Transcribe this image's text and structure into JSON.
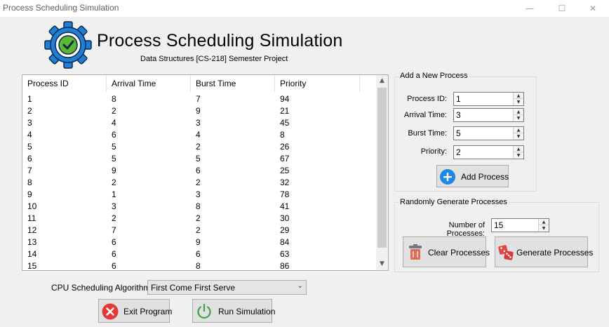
{
  "window": {
    "title": "Process Scheduling Simulation"
  },
  "header": {
    "title": "Process Scheduling Simulation",
    "subtitle": "Data Structures [CS-218] Semester Project"
  },
  "table": {
    "columns": [
      "Process ID",
      "Arrival Time",
      "Burst Time",
      "Priority"
    ],
    "rows": [
      [
        "1",
        "8",
        "7",
        "94"
      ],
      [
        "2",
        "2",
        "9",
        "21"
      ],
      [
        "3",
        "4",
        "3",
        "45"
      ],
      [
        "4",
        "6",
        "4",
        "8"
      ],
      [
        "5",
        "5",
        "2",
        "26"
      ],
      [
        "6",
        "5",
        "5",
        "67"
      ],
      [
        "7",
        "9",
        "6",
        "25"
      ],
      [
        "8",
        "2",
        "2",
        "32"
      ],
      [
        "9",
        "1",
        "3",
        "78"
      ],
      [
        "10",
        "3",
        "8",
        "41"
      ],
      [
        "11",
        "2",
        "2",
        "30"
      ],
      [
        "12",
        "7",
        "2",
        "29"
      ],
      [
        "13",
        "6",
        "9",
        "84"
      ],
      [
        "14",
        "6",
        "6",
        "63"
      ],
      [
        "15",
        "6",
        "8",
        "86"
      ]
    ]
  },
  "add_process": {
    "title": "Add a New Process",
    "process_id_label": "Process ID:",
    "process_id_value": "1",
    "arrival_label": "Arrival Time:",
    "arrival_value": "3",
    "burst_label": "Burst Time:",
    "burst_value": "5",
    "priority_label": "Priority:",
    "priority_value": "2",
    "add_button": "Add Process"
  },
  "random": {
    "title": "Randomly Generate Processes",
    "count_label": "Number of Processes:",
    "count_value": "15",
    "clear_button": "Clear Processes",
    "generate_button": "Generate Processes"
  },
  "algorithm": {
    "label": "CPU Scheduling Algorithm:",
    "selected": "First Come First Serve"
  },
  "footer": {
    "exit_button": "Exit Program",
    "run_button": "Run Simulation"
  },
  "colors": {
    "logo_blue": "#1e7fd6",
    "check_green": "#5cb82e",
    "add_blue": "#1e88e5",
    "exit_red": "#e53935",
    "run_green": "#43a047"
  }
}
